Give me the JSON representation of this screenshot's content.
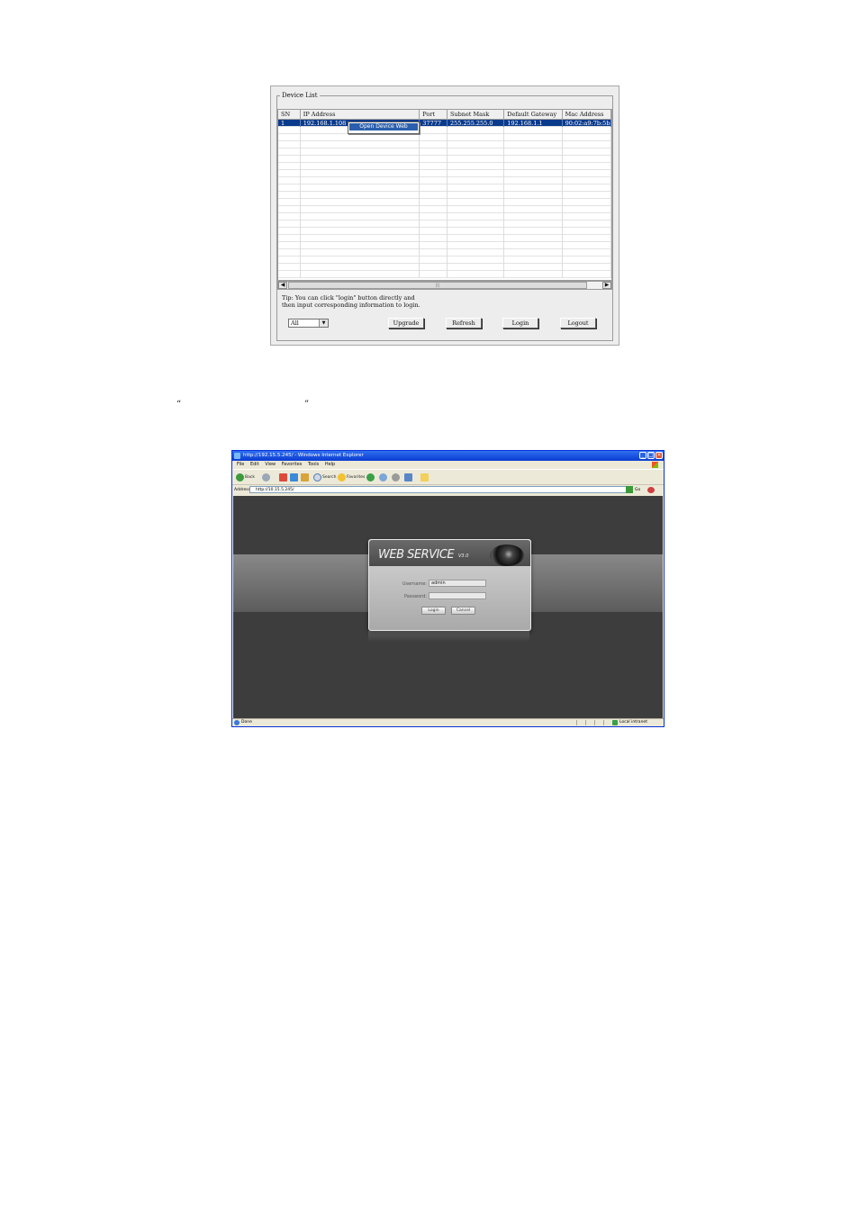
{
  "device_list": {
    "group_label": "Device List",
    "columns": [
      "SN",
      "IP Address",
      "Port",
      "Subnet Mask",
      "Default Gateway",
      "Mac Address"
    ],
    "rows": [
      [
        "1",
        "192.168.1.108",
        "37777",
        "255.255.255.0",
        "192.168.1.1",
        "90:02:a9:7b:5b"
      ]
    ],
    "context_menu_item": "Open Device Web",
    "tip_line1": "Tip: You can click \"login\" button directly and",
    "tip_line2": "then input corresponding information to login.",
    "filter_value": "All",
    "buttons": {
      "upgrade": "Upgrade",
      "refresh": "Refresh",
      "login": "Login",
      "logout": "Logout"
    }
  },
  "quotes": {
    "open": "“",
    "close": "”"
  },
  "browser": {
    "title": "http://192.15.5.245/ - Windows Internet Explorer",
    "menu": [
      "File",
      "Edit",
      "View",
      "Favorites",
      "Tools",
      "Help"
    ],
    "toolbar": {
      "back": "Back",
      "search": "Search",
      "favorites": "Favorites"
    },
    "address_label": "Address",
    "address_value": "http://10.15.5.245/",
    "go_label": "Go",
    "status_left": "Done",
    "status_right": "Local intranet"
  },
  "login": {
    "title": "WEB SERVICE",
    "version": "V3.0",
    "username_label": "Username:",
    "username_value": "admin",
    "password_label": "Password:",
    "password_value": "",
    "login_button": "Login",
    "cancel_button": "Cancel"
  },
  "colors": {
    "selection": "#0a3a8c",
    "xp_title": "#0a3bd0",
    "web_bg": "#3d3d3d"
  }
}
